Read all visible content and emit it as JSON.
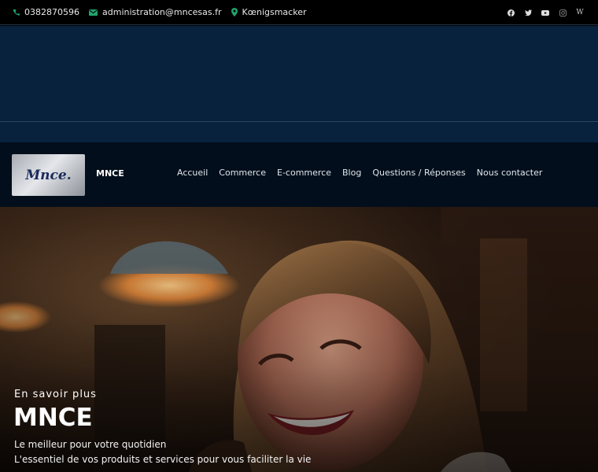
{
  "topbar": {
    "phone": "0382870596",
    "email": "administration@mncesas.fr",
    "location": "Kœnigsmacker",
    "social": [
      {
        "icon": "facebook-icon",
        "glyph": "f"
      },
      {
        "icon": "twitter-icon",
        "glyph": "t"
      },
      {
        "icon": "youtube-icon",
        "glyph": "▶"
      },
      {
        "icon": "instagram-icon",
        "glyph": "◎"
      },
      {
        "icon": "wikipedia-icon",
        "glyph": "W"
      }
    ]
  },
  "navbar": {
    "logo_text": "Mnce.",
    "brand": "MNCE",
    "menu": [
      "Accueil",
      "Commerce",
      "E-commerce",
      "Blog",
      "Questions / Réponses",
      "Nous contacter"
    ]
  },
  "hero": {
    "eyebrow": "En savoir plus",
    "headline": "MNCE",
    "line1": "Le meilleur pour votre quotidien",
    "line2": "L'essentiel de vos produits et services pour vous faciliter la vie"
  },
  "colors": {
    "banner": "#08213d",
    "navbar": "#020e1b",
    "accent_icon": "#1fa36b"
  }
}
